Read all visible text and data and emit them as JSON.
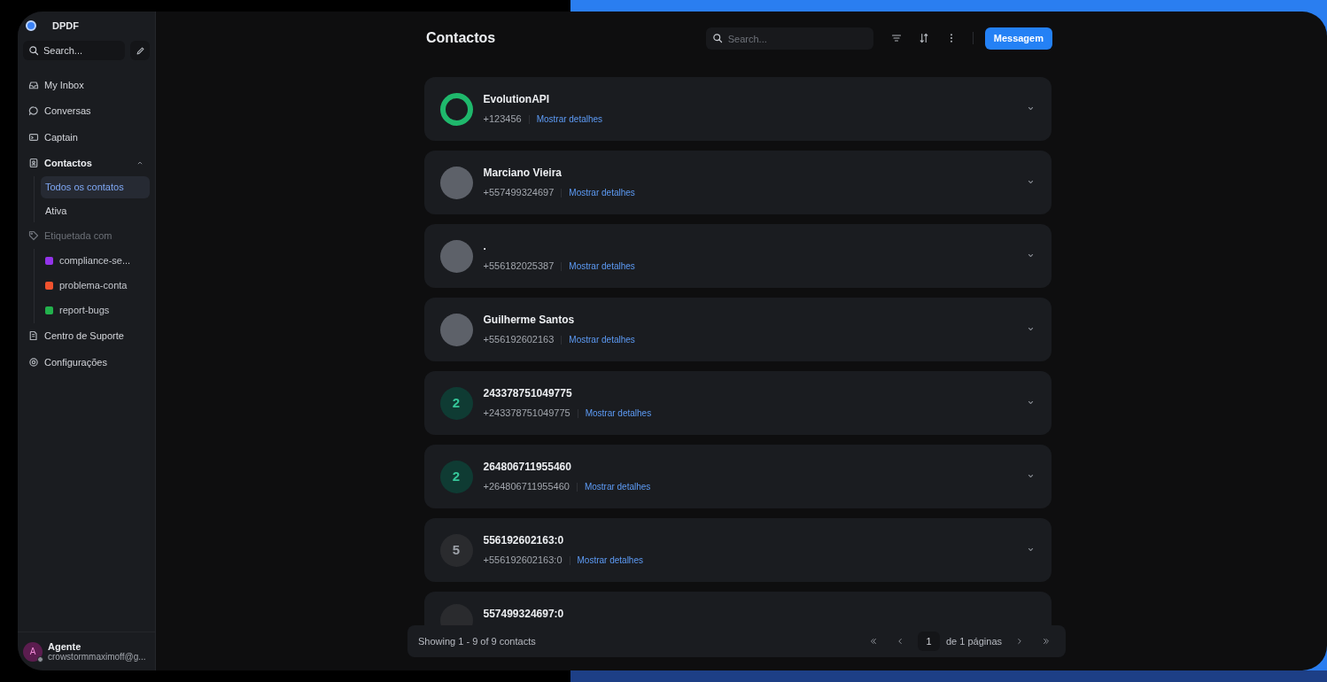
{
  "workspace": {
    "name": "DPDF"
  },
  "sidebar": {
    "search": {
      "placeholder": "Search..."
    },
    "items": [
      {
        "kind": "nav",
        "label": "My Inbox"
      },
      {
        "kind": "nav",
        "label": "Conversas"
      },
      {
        "kind": "nav",
        "label": "Captain"
      },
      {
        "kind": "group",
        "label": "Contactos",
        "expanded": true,
        "children": [
          {
            "label": "Todos os contatos",
            "selected": true
          },
          {
            "label": "Ativa",
            "selected": false
          }
        ]
      },
      {
        "kind": "labels",
        "label": "Etiquetada com",
        "children": [
          {
            "label": "compliance-se...",
            "color": "#9333ea"
          },
          {
            "label": "problema-conta",
            "color": "#f0522e"
          },
          {
            "label": "report-bugs",
            "color": "#22b14c"
          }
        ]
      },
      {
        "kind": "nav",
        "label": "Centro de Suporte"
      },
      {
        "kind": "nav",
        "label": "Configurações"
      }
    ],
    "user": {
      "initial": "A",
      "name": "Agente",
      "email": "crowstormmaximoff@g..."
    }
  },
  "header": {
    "title": "Contactos",
    "search": {
      "placeholder": "Search..."
    },
    "button": "Messagem"
  },
  "contacts": [
    {
      "kind": "ring",
      "name": "EvolutionAPI",
      "phone": "+123456",
      "link": "Mostrar detalhes"
    },
    {
      "kind": "photo",
      "name": "Marciano Vieira",
      "phone": "+557499324697",
      "link": "Mostrar detalhes"
    },
    {
      "kind": "photo",
      "name": ".",
      "phone": "+556182025387",
      "link": "Mostrar detalhes"
    },
    {
      "kind": "photo",
      "name": "Guilherme Santos",
      "phone": "+556192602163",
      "link": "Mostrar detalhes"
    },
    {
      "kind": "initial",
      "initial": "2",
      "color": "#0f3b33",
      "name": "243378751049775",
      "phone": "+243378751049775",
      "link": "Mostrar detalhes"
    },
    {
      "kind": "initial",
      "initial": "2",
      "color": "#0f3b33",
      "name": "264806711955460",
      "phone": "+264806711955460",
      "link": "Mostrar detalhes"
    },
    {
      "kind": "initial",
      "initial": "5",
      "color": "#2a2b2e",
      "name": "556192602163:0",
      "phone": "+556192602163:0",
      "link": "Mostrar detalhes"
    },
    {
      "kind": "initial",
      "color": "#2a2b2e",
      "name": "557499324697:0"
    }
  ],
  "footer": {
    "summary": "Showing 1 - 9 of 9 contacts",
    "page": "1",
    "pages": "de 1 páginas"
  }
}
